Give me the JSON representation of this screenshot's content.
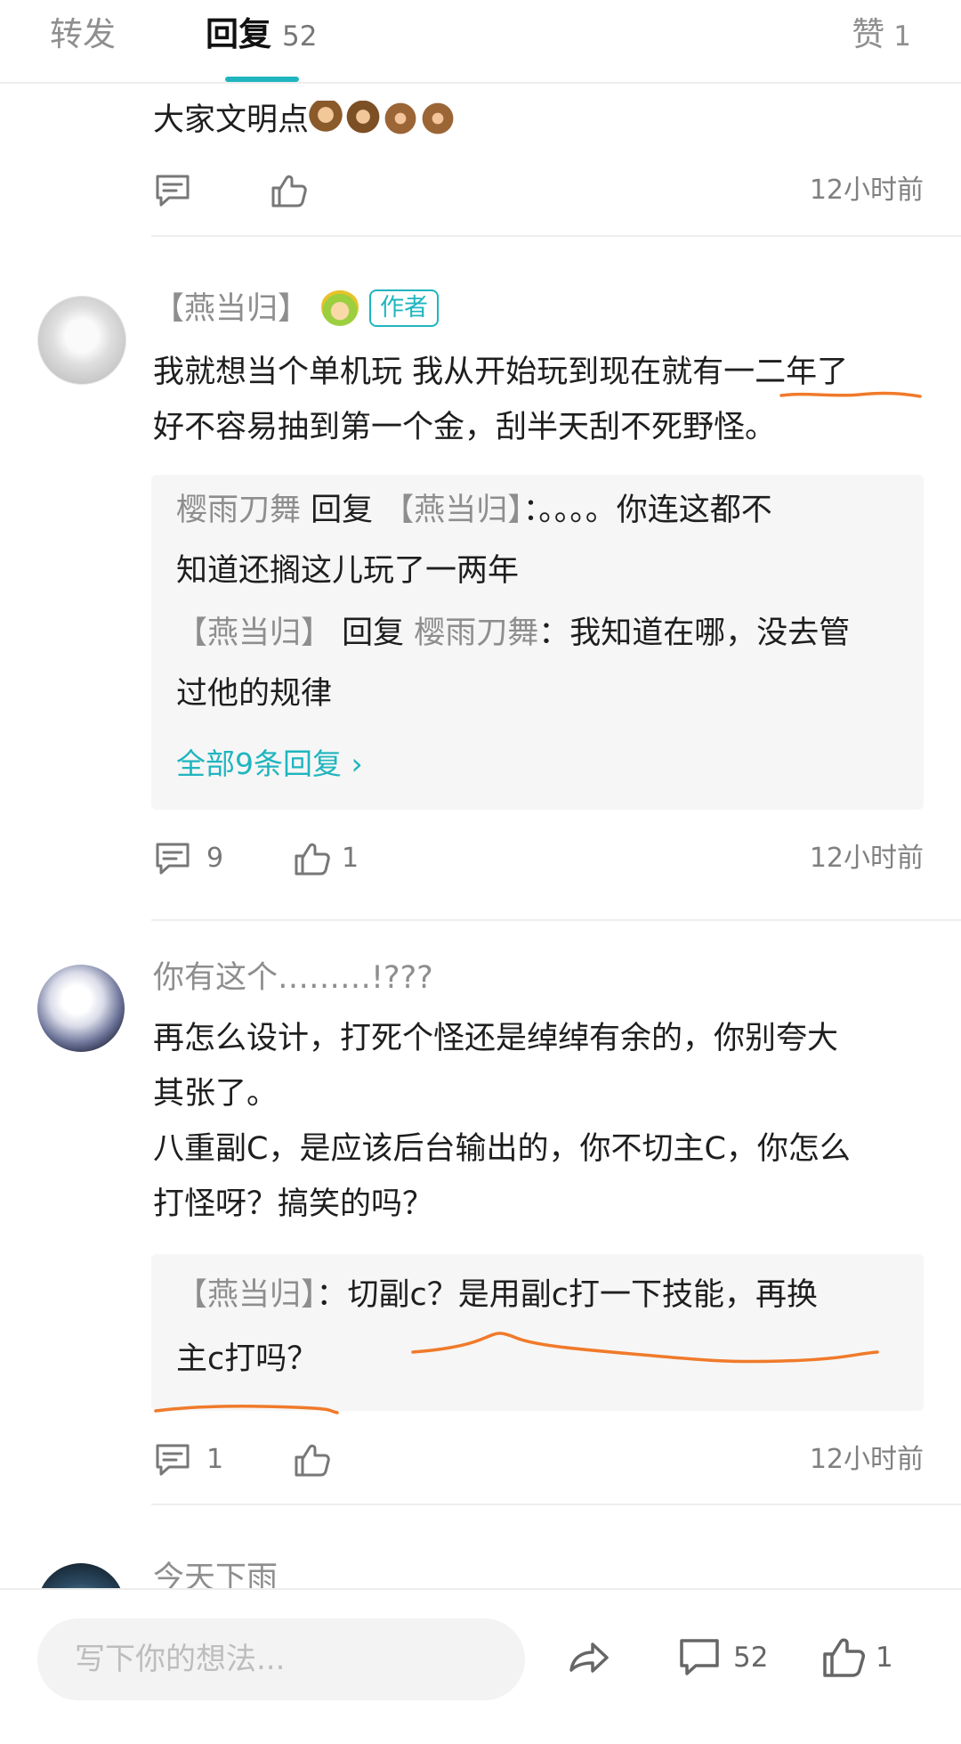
{
  "tabs": {
    "forward_label": "转发",
    "reply_label": "回复",
    "reply_count": "52",
    "like_label": "赞",
    "like_count": "1"
  },
  "comments": [
    {
      "text": "大家文明点",
      "emojis": [
        "monkey",
        "monkey",
        "see-no-evil-monkey",
        "see-no-evil-monkey"
      ],
      "reply_count": "",
      "like_count": "",
      "time": "12小时前"
    },
    {
      "name": "【燕当归】",
      "badge": "作者",
      "lines": [
        "我就想当个单机玩 我从开始玩到现在就有一二年了",
        "好不容易抽到第一个金，刮半天刮不死野怪。"
      ],
      "replies": [
        {
          "author": "樱雨刀舞",
          "verb": " 回复 ",
          "target": "【燕当归】",
          "text_line1": "：。。。。你连这都不",
          "text_line2": "知道还搁这儿玩了一两年"
        },
        {
          "author": "【燕当归】",
          "verb": " 回复 ",
          "target": "樱雨刀舞",
          "text_line1": "：我知道在哪，没去管",
          "text_line2": "过他的规律"
        }
      ],
      "more_replies": "全部9条回复",
      "more_arrow": "›",
      "reply_count": "9",
      "like_count": "1",
      "time": "12小时前"
    },
    {
      "name": "你有这个………!???",
      "lines": [
        "再怎么设计，打死个怪还是绰绰有余的，你别夸大",
        "其张了。",
        "八重副C，是应该后台输出的，你不切主C，你怎么",
        "打怪呀？搞笑的吗？"
      ],
      "replies": [
        {
          "author": "【燕当归】",
          "text_line1": "：切副c？是用副c打一下技能，再换",
          "text_line2": "主c打吗？"
        }
      ],
      "reply_count": "1",
      "like_count": "",
      "time": "12小时前"
    },
    {
      "name": "今天下雨"
    }
  ],
  "bottom_bar": {
    "input_placeholder": "写下你的想法...",
    "comment_count": "52",
    "like_count": "1"
  },
  "colors": {
    "accent": "#1fb5bf",
    "annotation": "#f07a2a",
    "reply_bg": "#f6f6f6"
  }
}
